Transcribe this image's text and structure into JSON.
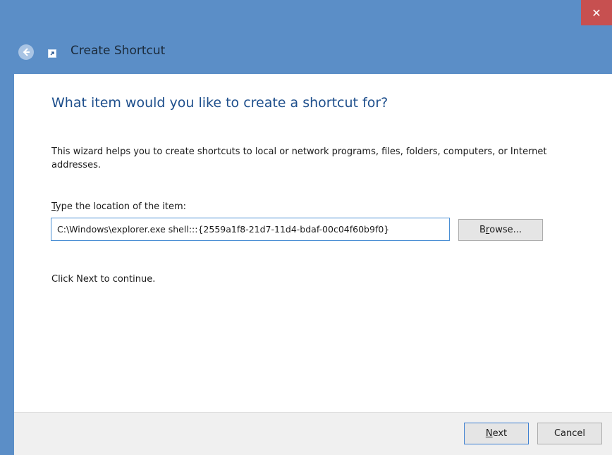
{
  "window": {
    "title": "Create Shortcut",
    "close_glyph": "✕"
  },
  "icons": {
    "back": "back-arrow-icon",
    "shortcut": "shortcut-icon",
    "close": "close-icon"
  },
  "content": {
    "heading": "What item would you like to create a shortcut for?",
    "description": "This wizard helps you to create shortcuts to local or network programs, files, folders, computers, or Internet addresses.",
    "location_label_accel": "T",
    "location_label_rest": "ype the location of the item:",
    "location_value": "C:\\Windows\\explorer.exe shell:::{2559a1f8-21d7-11d4-bdaf-00c04f60b9f0}",
    "browse_accel": "r",
    "browse_pre": "B",
    "browse_post": "owse...",
    "continue_text": "Click Next to continue."
  },
  "footer": {
    "next_accel": "N",
    "next_rest": "ext",
    "cancel_label": "Cancel"
  },
  "colors": {
    "titlebar": "#5b8ec7",
    "close_button": "#c75050",
    "heading": "#1e4f8c",
    "input_border": "#4a8fd4"
  }
}
